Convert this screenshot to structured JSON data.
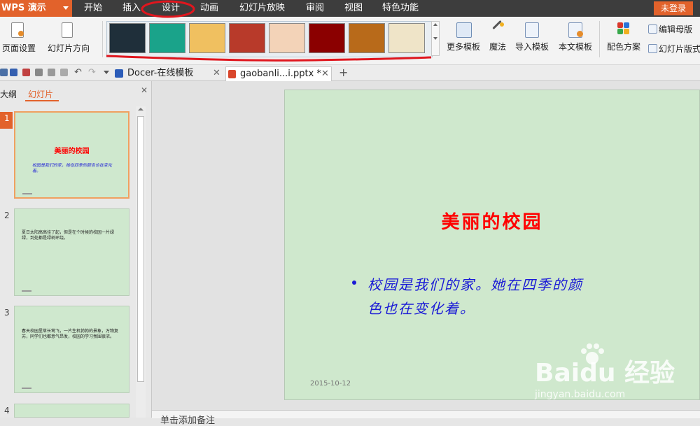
{
  "app": {
    "name": "WPS 演示"
  },
  "menu": {
    "items": [
      "开始",
      "插入",
      "设计",
      "动画",
      "幻灯片放映",
      "审阅",
      "视图",
      "特色功能"
    ],
    "login": "未登录"
  },
  "ribbon": {
    "page_setup": "页面设置",
    "slide_orientation": "幻灯片方向",
    "more_templates": "更多模板",
    "magic": "魔法",
    "import_template": "导入模板",
    "text_template": "本文模板",
    "color_scheme": "配色方案",
    "edit_master": "编辑母版",
    "slide_version": "幻灯片版式",
    "thumbnail_colors": [
      "#1f2f3a",
      "#1aa38a",
      "#f0c060",
      "#b83a2a",
      "#f3d3b8",
      "#8b0000",
      "#b86a1a",
      "#efe4c8"
    ]
  },
  "tabs": {
    "docer": "Docer-在线模板",
    "file": "gaobanli...i.pptx *",
    "add": "+"
  },
  "pane": {
    "outline_tab": "大纲",
    "slides_tab": "幻灯片"
  },
  "slides": [
    {
      "num": "1",
      "title": "美丽的校园",
      "body": "校园是我们的家，她在四季的颜色也在变化着。"
    },
    {
      "num": "2",
      "body": "夏日太阳高高挂了起，但是在个时候的校园一片绿绿，到处都是绿树环绕。"
    },
    {
      "num": "3",
      "body": "春天校园里草长莺飞，一片生机勃勃的景象，万物复苏，同学们也都意气昂发，校园的学习氛围很浓。"
    },
    {
      "num": "4"
    }
  ],
  "main_slide": {
    "title": "美丽的校园",
    "body_line1": "校园是我们的家。她在四季的颜",
    "body_line2": "色也在变化着。",
    "date": "2015-10-12"
  },
  "notes": {
    "placeholder": "单击添加备注"
  },
  "watermark": {
    "brand": "Baidu 经验",
    "url": "jingyan.baidu.com"
  }
}
